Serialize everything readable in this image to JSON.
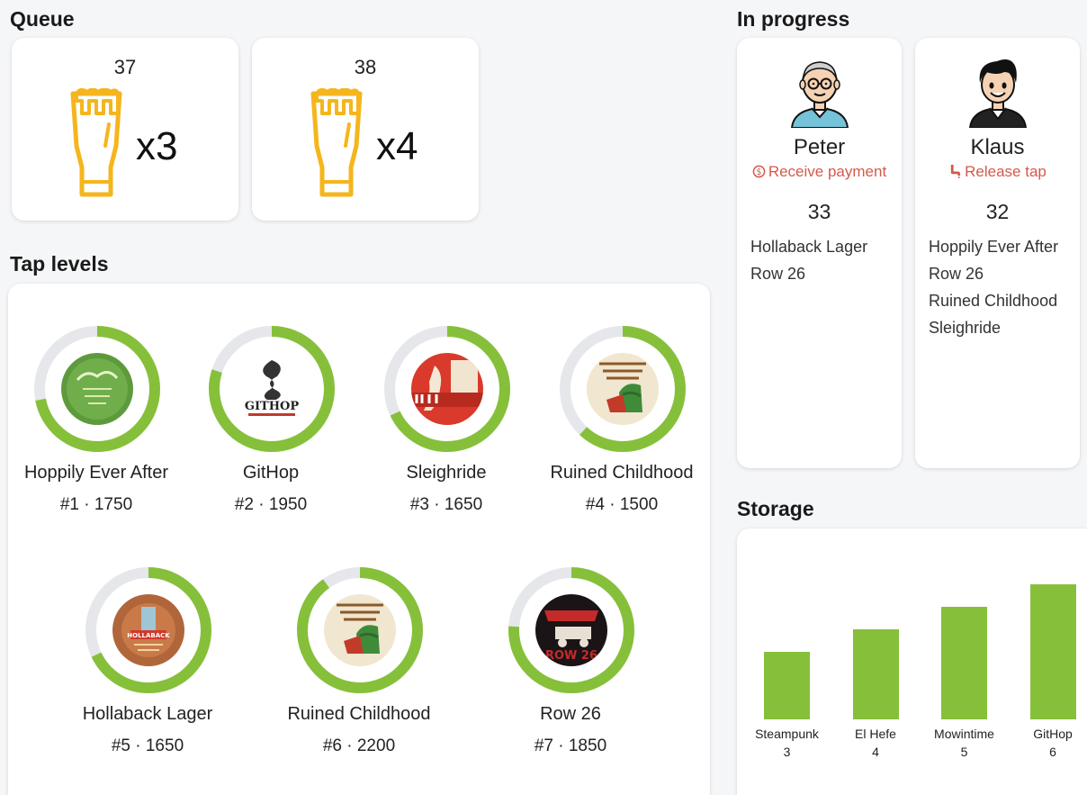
{
  "queue": {
    "title": "Queue",
    "orders": [
      {
        "number": "37",
        "count": "x3"
      },
      {
        "number": "38",
        "count": "x4"
      }
    ]
  },
  "in_progress": {
    "title": "In progress",
    "orders": [
      {
        "name": "Peter",
        "action": "Receive payment",
        "action_icon": "dollar-circle-icon",
        "number": "33",
        "items": [
          "Hollaback Lager",
          "Row 26"
        ]
      },
      {
        "name": "Klaus",
        "action": "Release tap",
        "action_icon": "tap-icon",
        "number": "32",
        "items": [
          "Hoppily Ever After",
          "Row 26",
          "Ruined Childhood",
          "Sleighride"
        ]
      }
    ]
  },
  "tap_levels": {
    "title": "Tap levels",
    "taps": [
      {
        "name": "Hoppily Ever After",
        "meta": "#1  ·  1750",
        "level": 0.72
      },
      {
        "name": "GitHop",
        "meta": "#2  ·  1950",
        "level": 0.8
      },
      {
        "name": "Sleighride",
        "meta": "#3  ·  1650",
        "level": 0.68
      },
      {
        "name": "Ruined Childhood",
        "meta": "#4  ·  1500",
        "level": 0.62
      },
      {
        "name": "Hollaback Lager",
        "meta": "#5  ·  1650",
        "level": 0.68
      },
      {
        "name": "Ruined Childhood",
        "meta": "#6  ·  2200",
        "level": 0.9
      },
      {
        "name": "Row 26",
        "meta": "#7  ·  1850",
        "level": 0.76
      }
    ]
  },
  "storage": {
    "title": "Storage",
    "chart_data": {
      "type": "bar",
      "categories": [
        "Steampunk",
        "El Hefe",
        "Mowintime",
        "GitHop"
      ],
      "values": [
        3,
        4,
        5,
        6
      ]
    }
  },
  "colors": {
    "accent": "#86c03a",
    "track": "#e6e7ea",
    "beer": "#f5b51c",
    "action": "#d4594c"
  }
}
